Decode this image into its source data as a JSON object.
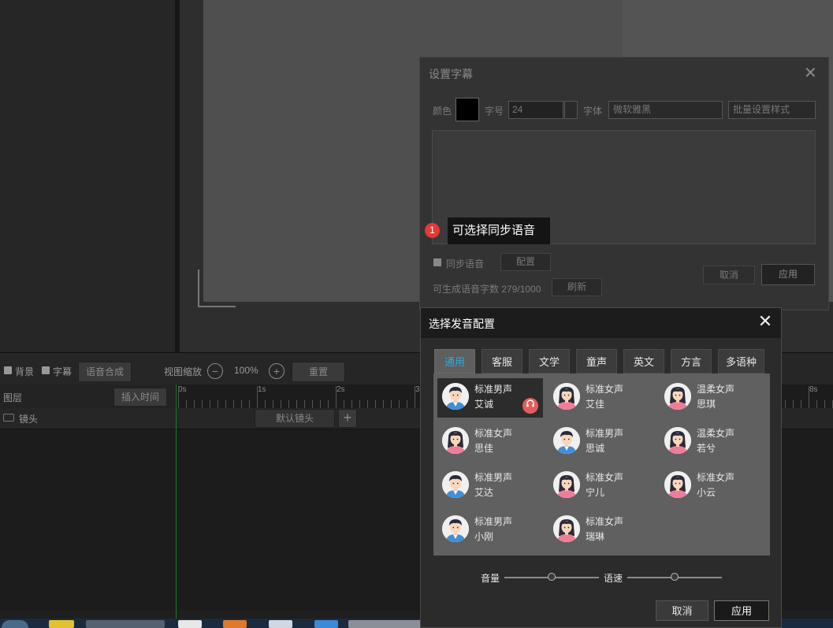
{
  "editor": {
    "timeline": {
      "bg_label": "背景",
      "subtitle_label": "字幕",
      "tts_button": "语音合成",
      "zoom_label": "视图缩放",
      "zoom_minus": "−",
      "zoom_value": "100%",
      "zoom_plus": "+",
      "reset_button": "重置",
      "layers_label": "图层",
      "insert_time_button": "插入时间",
      "shot_label": "镜头",
      "default_shot": "默认镜头",
      "add_shot": "+",
      "ruler_labels": [
        "0s",
        "1s",
        "2s",
        "3",
        "8s"
      ]
    }
  },
  "subtitle_dialog": {
    "title": "设置字幕",
    "close": "✕",
    "color_label": "颜色",
    "size_label": "字号",
    "size_value": "24",
    "font_label": "字体",
    "font_value": "微软雅黑",
    "batch_style": "批量设置样式",
    "sync_voice_label": "同步语音",
    "config_button": "配置",
    "char_count": "可生成语音字数 279/1000",
    "refresh_button": "刷新",
    "cancel_button": "取消",
    "apply_button": "应用"
  },
  "tooltip": {
    "badge": "1",
    "text": "可选择同步语音"
  },
  "voice_dialog": {
    "title": "选择发音配置",
    "close": "✕",
    "tabs": [
      {
        "label": "通用",
        "active": true
      },
      {
        "label": "客服",
        "active": false
      },
      {
        "label": "文学",
        "active": false
      },
      {
        "label": "童声",
        "active": false
      },
      {
        "label": "英文",
        "active": false
      },
      {
        "label": "方言",
        "active": false
      },
      {
        "label": "多语种",
        "active": false
      }
    ],
    "voices": [
      {
        "type": "标准男声",
        "name": "艾诚",
        "gender": "male",
        "selected": true
      },
      {
        "type": "标准女声",
        "name": "艾佳",
        "gender": "female",
        "selected": false
      },
      {
        "type": "温柔女声",
        "name": "思琪",
        "gender": "female",
        "selected": false
      },
      {
        "type": "标准女声",
        "name": "思佳",
        "gender": "female",
        "selected": false
      },
      {
        "type": "标准男声",
        "name": "思诚",
        "gender": "male",
        "selected": false
      },
      {
        "type": "温柔女声",
        "name": "若兮",
        "gender": "female",
        "selected": false
      },
      {
        "type": "标准男声",
        "name": "艾达",
        "gender": "male",
        "selected": false
      },
      {
        "type": "标准女声",
        "name": "宁儿",
        "gender": "female",
        "selected": false
      },
      {
        "type": "标准女声",
        "name": "小云",
        "gender": "female",
        "selected": false
      },
      {
        "type": "标准男声",
        "name": "小刚",
        "gender": "male",
        "selected": false
      },
      {
        "type": "标准女声",
        "name": "瑞琳",
        "gender": "female",
        "selected": false
      }
    ],
    "play_icon": "headphones-icon",
    "volume_label": "音量",
    "volume_level": 0.5,
    "speed_label": "语速",
    "speed_level": 0.5,
    "cancel_button": "取消",
    "apply_button": "应用"
  },
  "colors": {
    "accent": "#2ea9e6",
    "badge_red": "#e53935",
    "play_red": "#e25d5d",
    "male_shirt": "#3f8fd9",
    "female_shirt": "#ee7d9a"
  }
}
